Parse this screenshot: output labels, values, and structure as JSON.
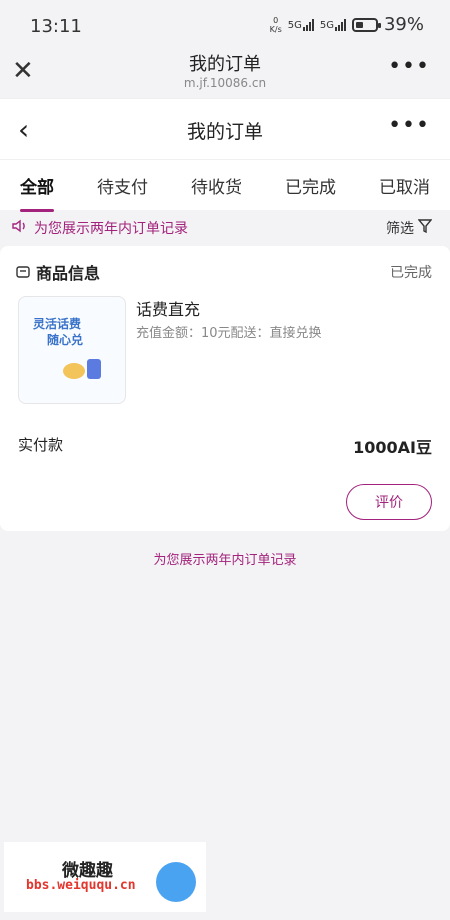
{
  "status_bar": {
    "time": "13:11",
    "net_speed_value": "0",
    "net_speed_unit": "K/s",
    "signal1": "5G",
    "signal2": "5G",
    "battery_pct": "39%",
    "battery_level": 0.39
  },
  "browser": {
    "title": "我的订单",
    "url": "m.jf.10086.cn",
    "close_icon": "close-icon",
    "more_icon": "more-icon"
  },
  "app_header": {
    "title": "我的订单",
    "back_icon": "back-icon",
    "more_icon": "more-icon"
  },
  "tabs": [
    {
      "label": "全部",
      "active": true
    },
    {
      "label": "待支付"
    },
    {
      "label": "待收货"
    },
    {
      "label": "已完成"
    },
    {
      "label": "已取消"
    }
  ],
  "notice": {
    "text": "为您展示两年内订单记录",
    "filter_label": "筛选"
  },
  "order": {
    "section_title": "商品信息",
    "status": "已完成",
    "image_text_1": "灵活话费",
    "image_text_2": "随心兑",
    "product_name": "话费直充",
    "product_desc": "充值金额：10元配送：直接兑换",
    "paid_label": "实付款",
    "paid_amount": "1000AI豆",
    "rate_button": "评价"
  },
  "footer_notice": "为您展示两年内订单记录",
  "watermark": {
    "title": "微趣趣",
    "url": "bbs.weiququ.cn"
  },
  "colors": {
    "accent": "#a3237c",
    "background": "#f3f3f5"
  }
}
